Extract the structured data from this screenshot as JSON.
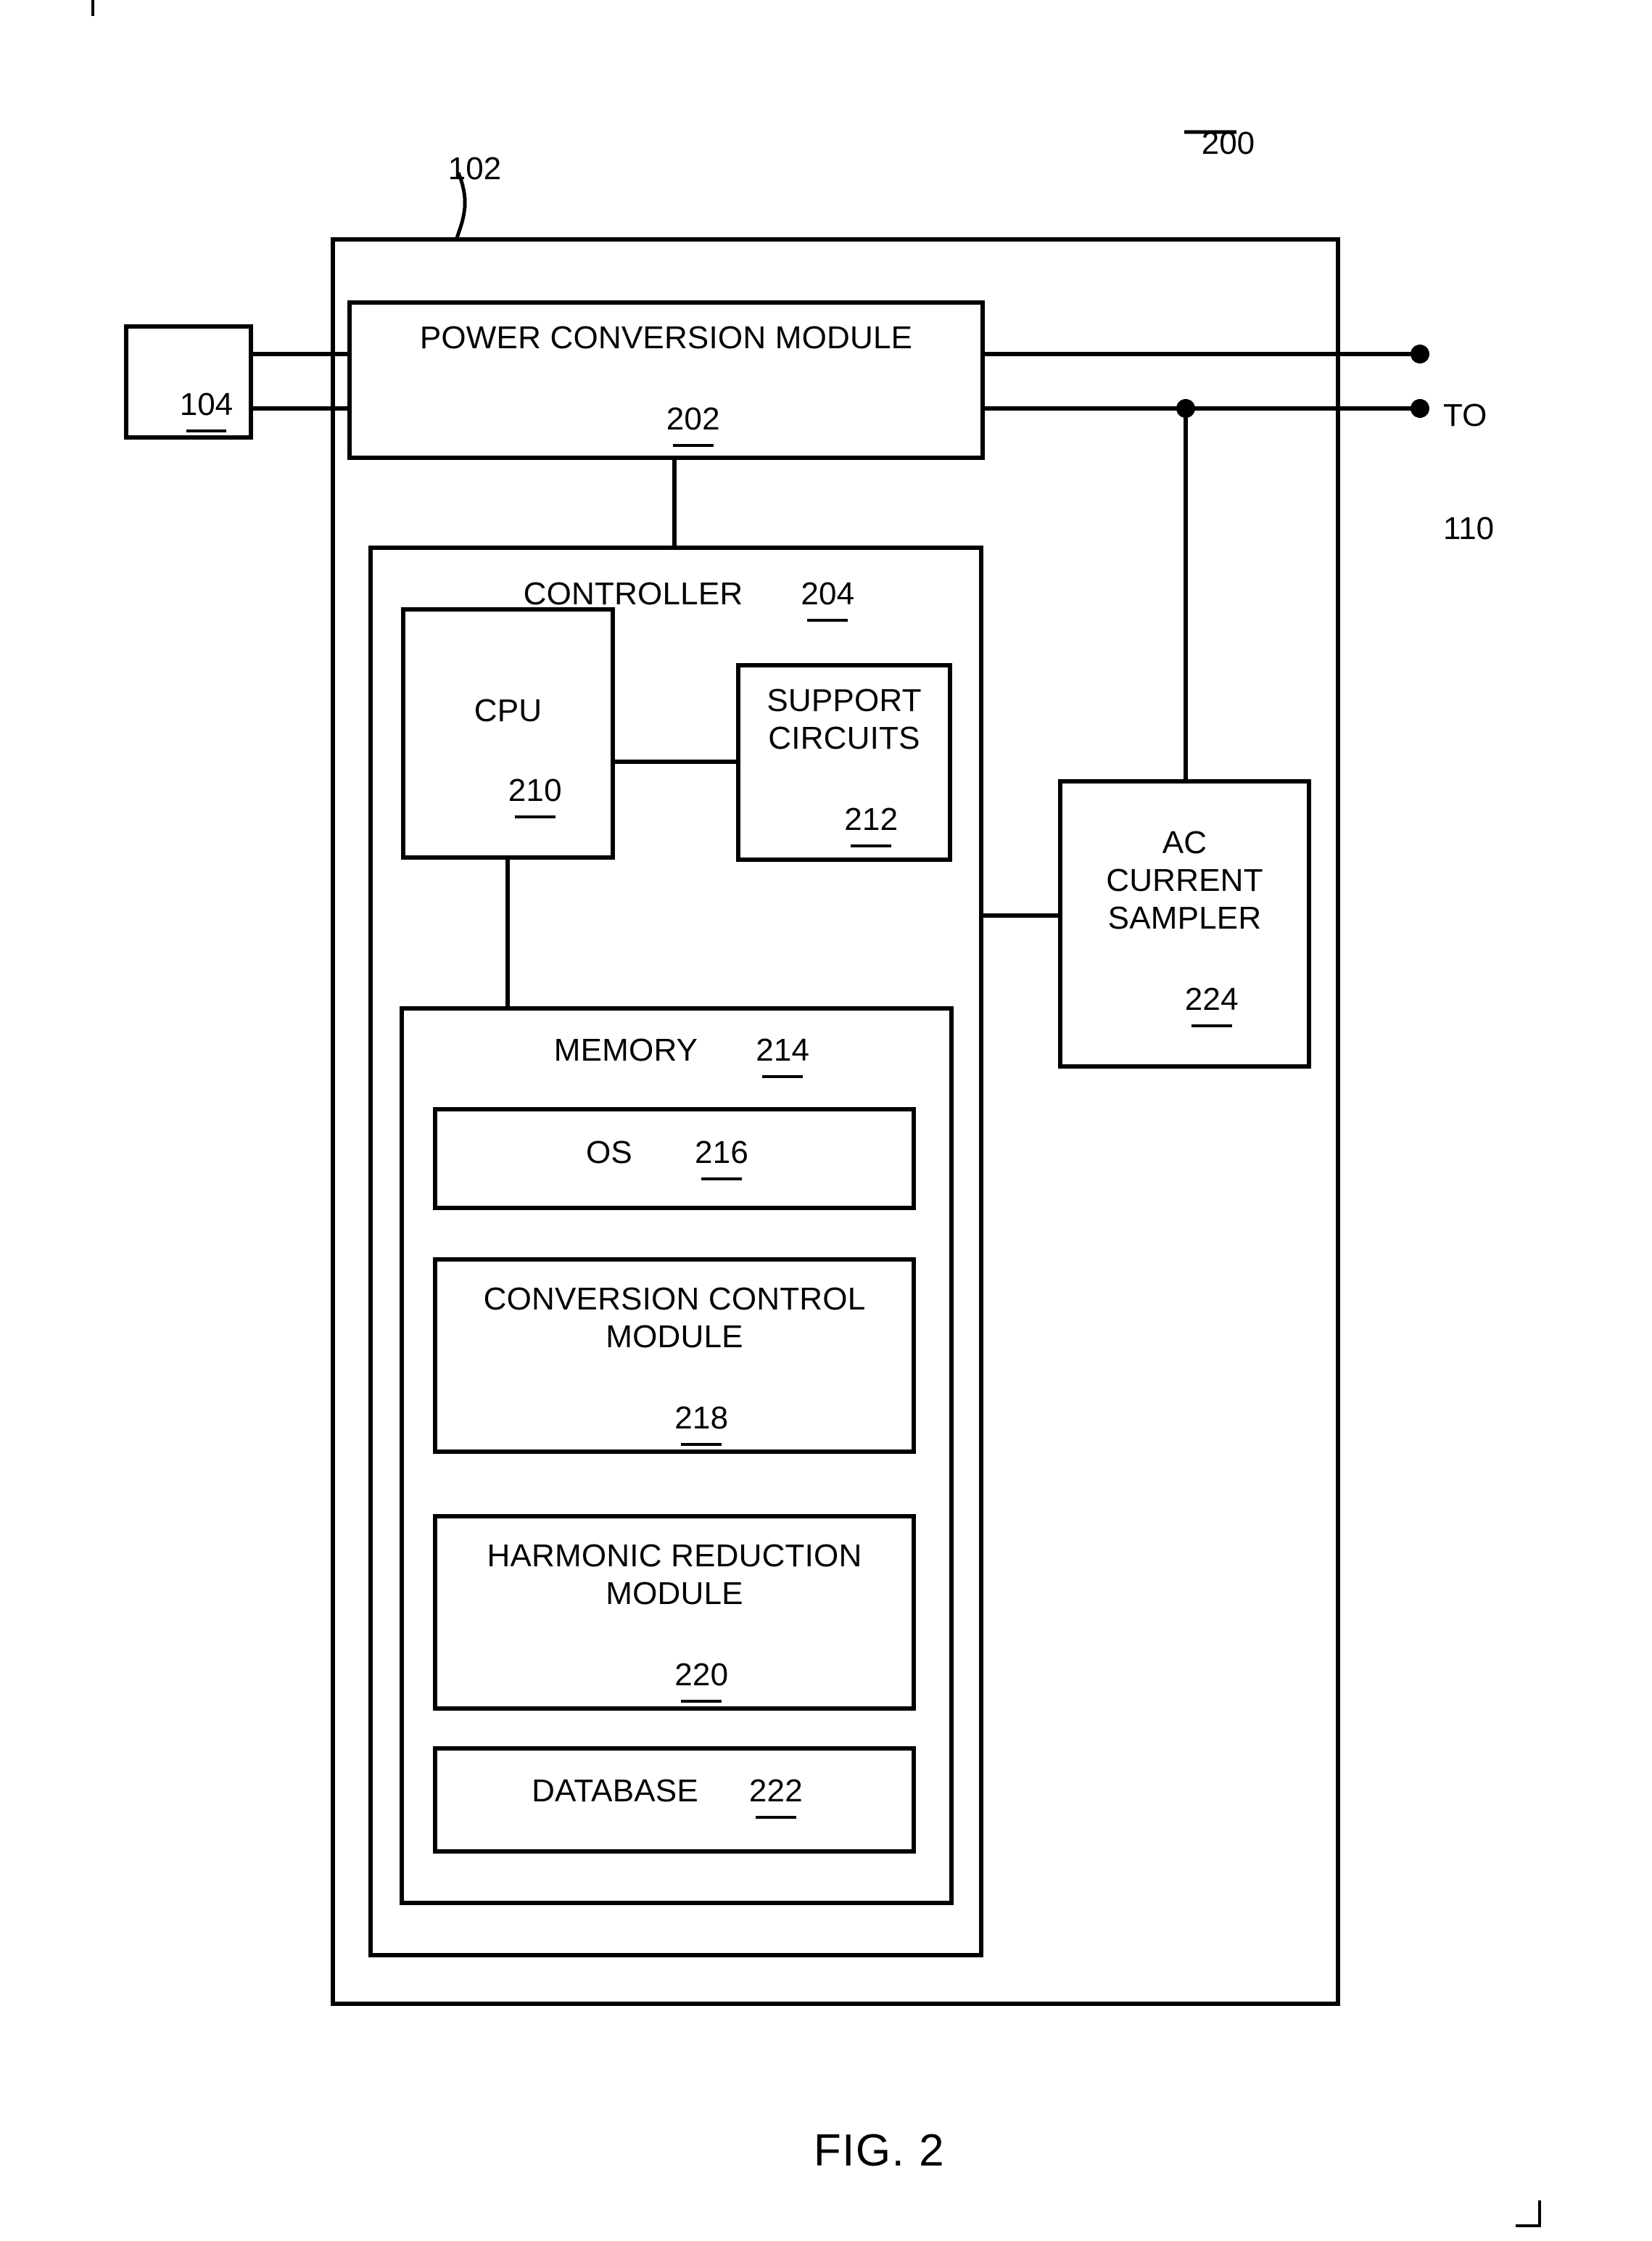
{
  "figure": {
    "caption": "FIG. 2",
    "system_ref": "200",
    "enclosure_ref": "102",
    "external_source_ref": "104",
    "output_label_line1": "TO",
    "output_label_line2": "110"
  },
  "blocks": {
    "power_conversion_module": {
      "title": "POWER CONVERSION MODULE",
      "ref": "202"
    },
    "controller": {
      "title": "CONTROLLER",
      "ref": "204"
    },
    "cpu": {
      "title": "CPU",
      "ref": "210"
    },
    "support_circuits": {
      "title_line1": "SUPPORT",
      "title_line2": "CIRCUITS",
      "ref": "212"
    },
    "ac_current_sampler": {
      "title_line1": "AC",
      "title_line2": "CURRENT",
      "title_line3": "SAMPLER",
      "ref": "224"
    },
    "memory": {
      "title": "MEMORY",
      "ref": "214"
    },
    "os": {
      "title": "OS",
      "ref": "216"
    },
    "conversion_control_module": {
      "title_line1": "CONVERSION CONTROL",
      "title_line2": "MODULE",
      "ref": "218"
    },
    "harmonic_reduction_module": {
      "title_line1": "HARMONIC REDUCTION",
      "title_line2": "MODULE",
      "ref": "220"
    },
    "database": {
      "title": "DATABASE",
      "ref": "222"
    }
  },
  "colors": {
    "line": "#000000",
    "background": "#ffffff"
  }
}
